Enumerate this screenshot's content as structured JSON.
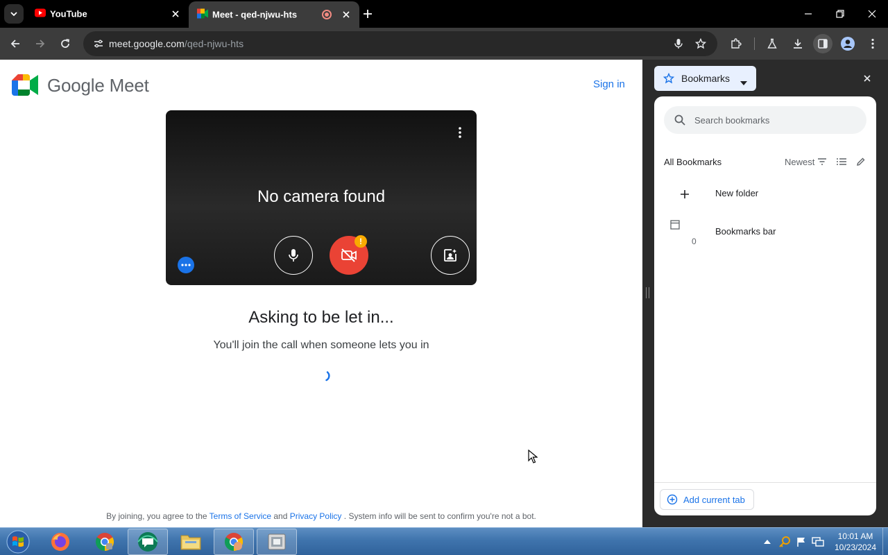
{
  "browser": {
    "tabs": [
      {
        "title": "YouTube",
        "active": false
      },
      {
        "title": "Meet - qed-njwu-hts",
        "active": true
      }
    ],
    "url_host": "meet.google.com",
    "url_path": "/qed-njwu-hts"
  },
  "meet": {
    "wordmark": "Google Meet",
    "sign_in": "Sign in",
    "no_camera": "No camera found",
    "asking_title": "Asking to be let in...",
    "asking_subtitle": "You'll join the call when someone lets you in",
    "camera_badge": "!",
    "terms": {
      "prefix": "By joining, you agree to the",
      "tos": "Terms of Service",
      "and": "and",
      "privacy": "Privacy Policy",
      "suffix": ". System info will be sent to confirm you're not a bot."
    }
  },
  "bookmarks": {
    "panel_title": "Bookmarks",
    "search_placeholder": "Search bookmarks",
    "section_title": "All Bookmarks",
    "sort_label": "Newest",
    "items": [
      {
        "name": "New folder",
        "count": ""
      },
      {
        "name": "Bookmarks bar",
        "count": "0"
      }
    ],
    "add_current_tab": "Add current tab"
  },
  "taskbar": {
    "time": "10:01 AM",
    "date": "10/23/2024"
  },
  "colors": {
    "meet_blue": "#1a73e8",
    "camera_off_red": "#ea4335",
    "warning_amber": "#f9ab00"
  }
}
